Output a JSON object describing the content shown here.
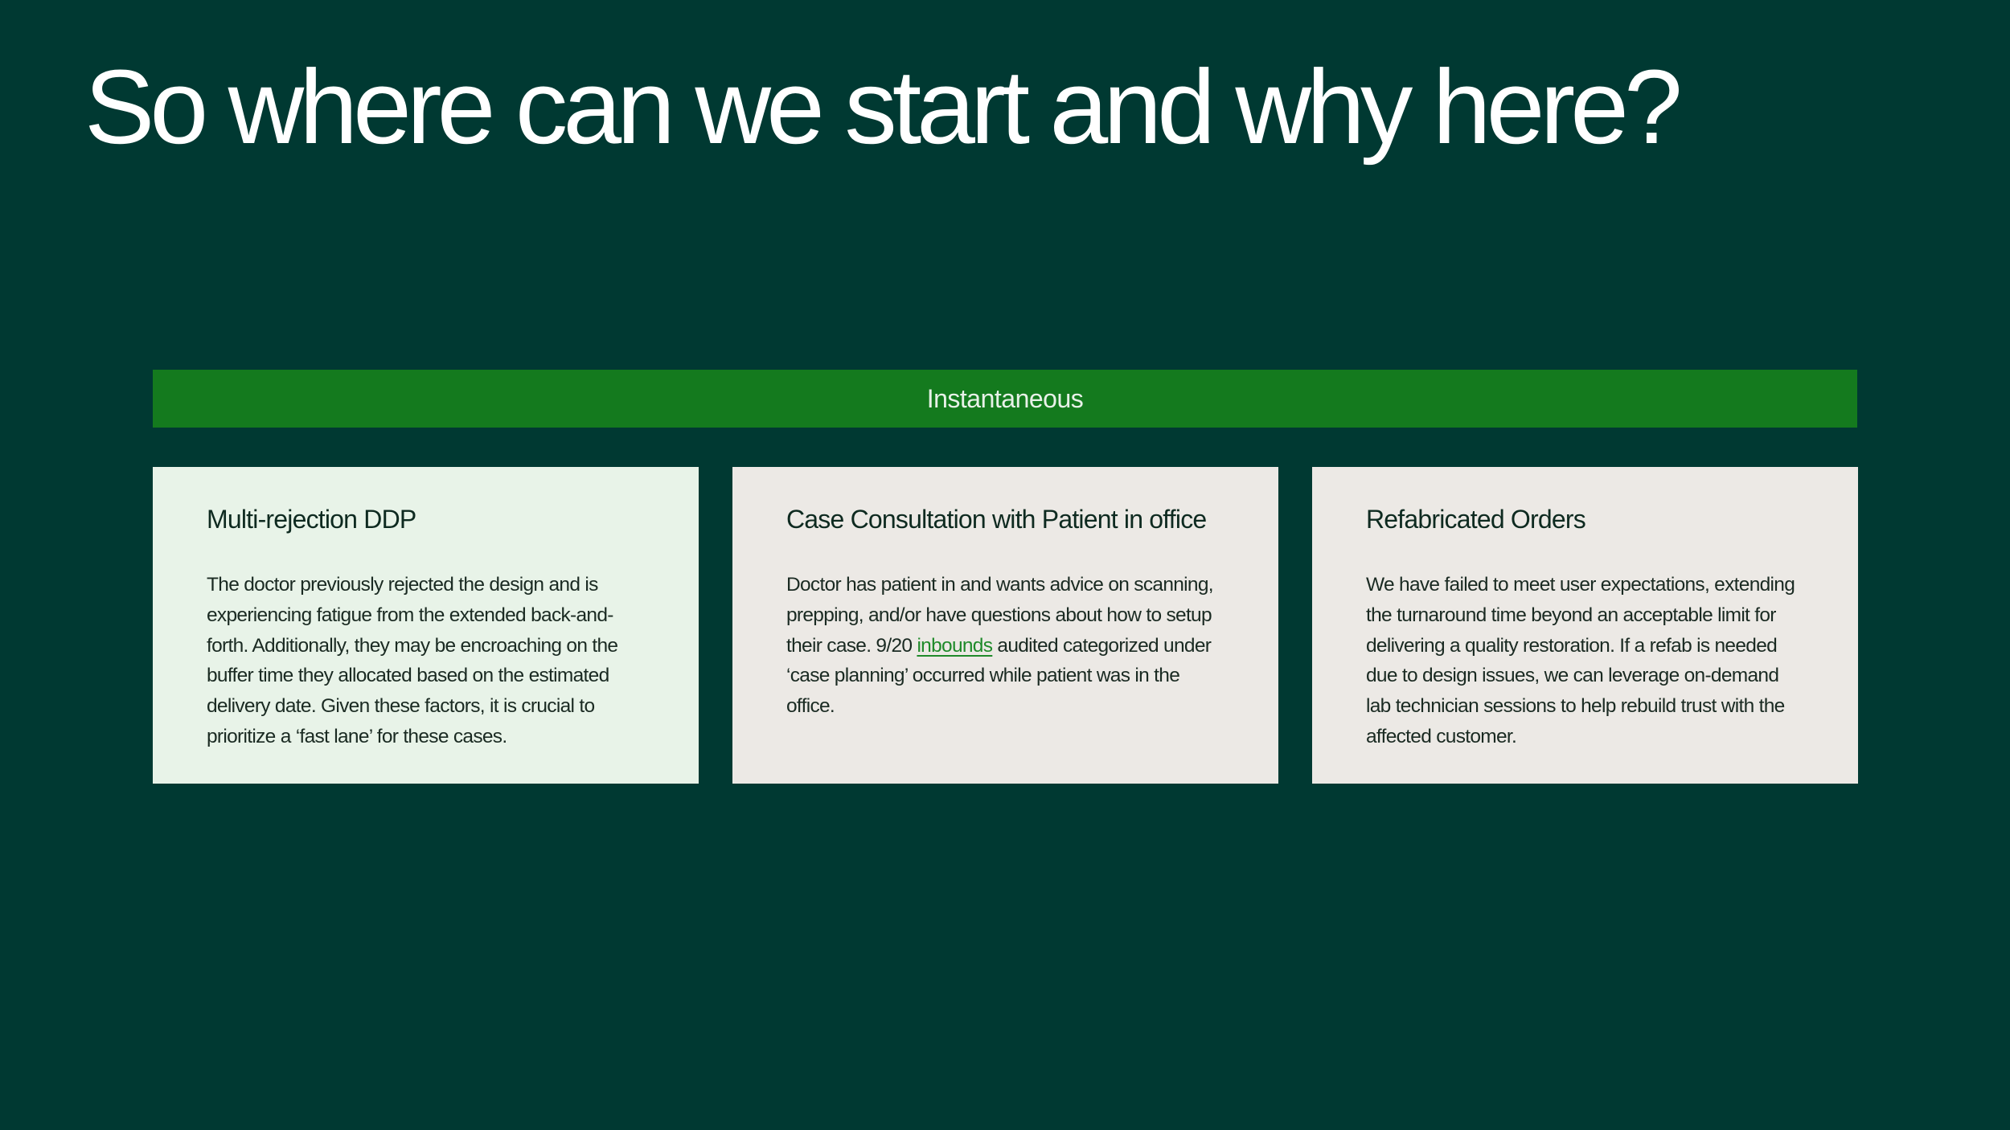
{
  "slide": {
    "title": "So where can we start and why here?"
  },
  "banner": {
    "label": "Instantaneous"
  },
  "cards": [
    {
      "title": "Multi-rejection DDP",
      "body": "The doctor previously rejected the design and is experiencing fatigue from the extended back-and-forth. Additionally, they may be encroaching on the buffer time they allocated based on the estimated delivery date. Given these factors, it is crucial to prioritize a ‘fast lane’ for these cases."
    },
    {
      "title": "Case Consultation with Patient in office",
      "body_before": "Doctor has patient in and wants advice on scanning, prepping, and/or have questions about how to setup their case.  9/20 ",
      "body_link": "inbounds",
      "body_after": " audited categorized under ‘case planning’ occurred while patient was in the office."
    },
    {
      "title": "Refabricated Orders",
      "body": "We have failed to meet user expectations, extending the turnaround time beyond an acceptable limit for delivering a quality restoration. If a refab is needed due to design issues, we can leverage on-demand lab technician sessions to help rebuild trust with the affected customer."
    }
  ],
  "colors": {
    "background": "#003932",
    "banner": "#147a1e",
    "card_highlight": "#e8f3e8",
    "card": "#ece9e5",
    "link": "#1f8a2a"
  }
}
